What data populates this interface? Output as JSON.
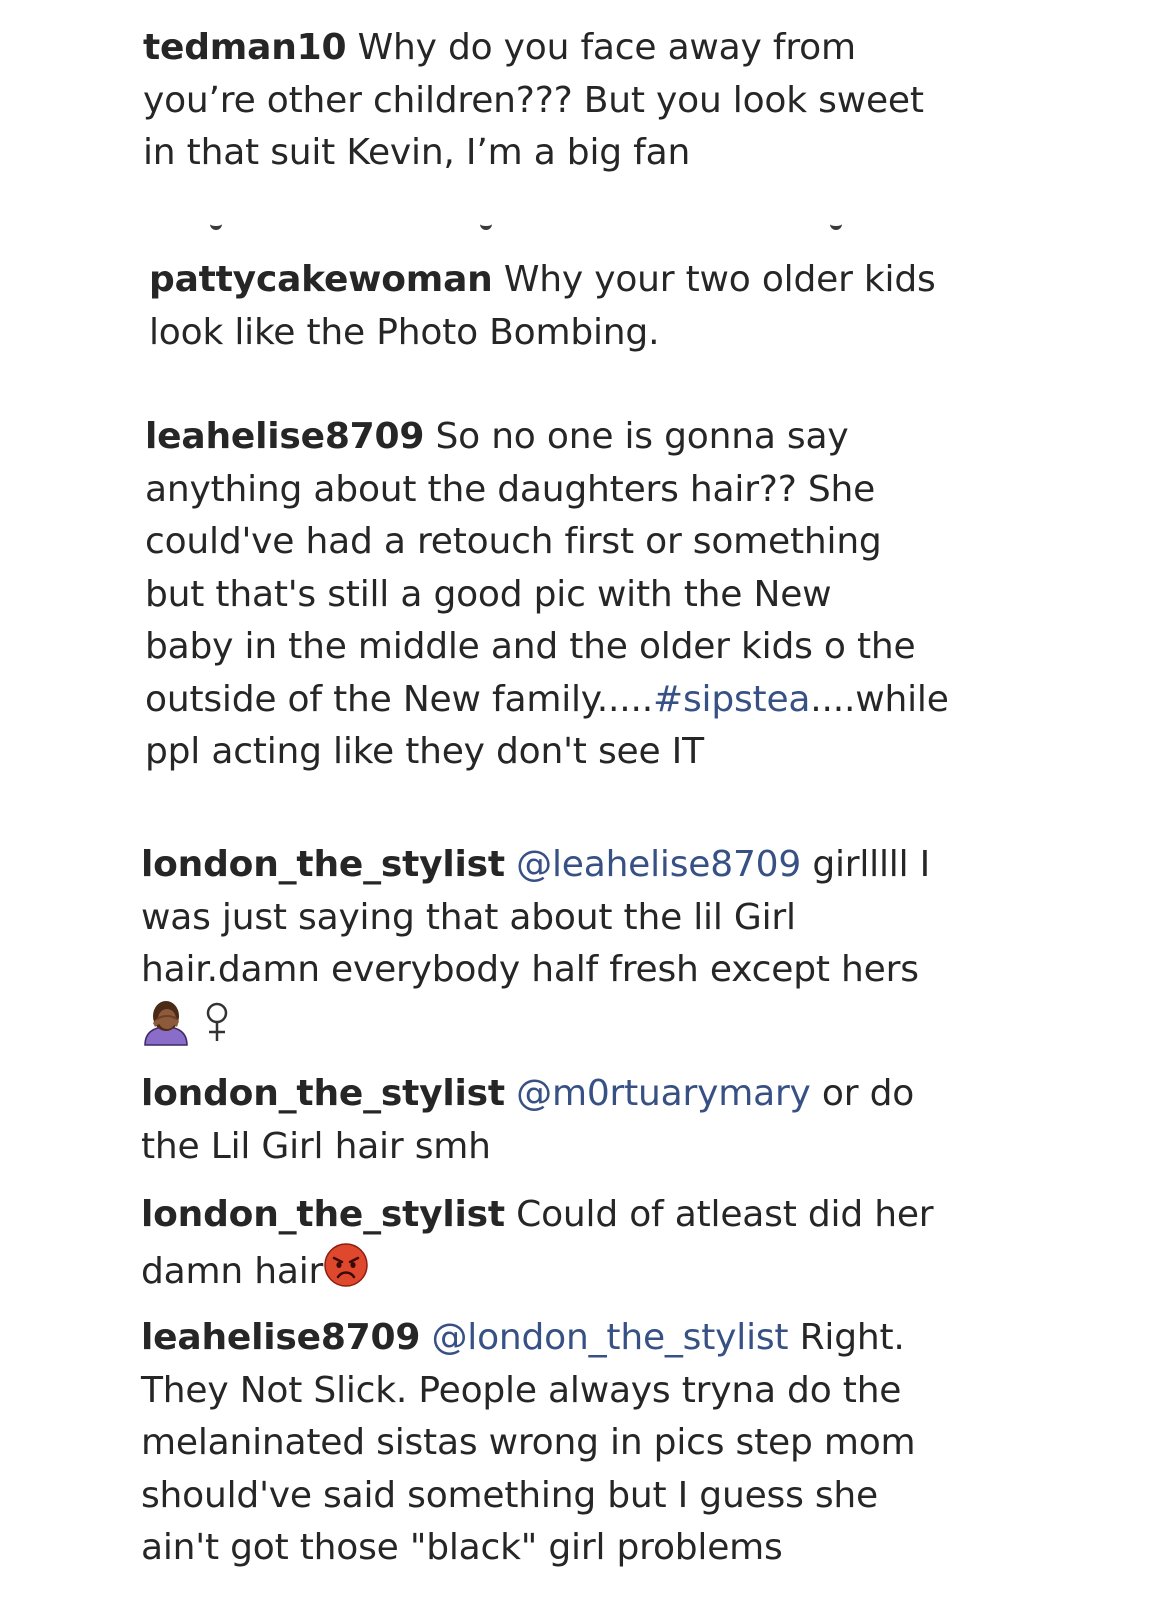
{
  "comments": [
    {
      "username": "tedman10",
      "lines": [
        "Why do you face away from",
        "you’re other children??? But you look sweet",
        "in that suit Kevin, I’m a big fan"
      ]
    },
    {
      "username": "pattycakewoman",
      "lines": [
        "Why your two older kids",
        "look like the Photo Bombing."
      ]
    },
    {
      "username": "leahelise8709",
      "lines": [
        "So no one is gonna say",
        "anything about the daughters hair?? She",
        "could've had a retouch first or something",
        "but that's still a good pic with the New",
        "baby in the middle and the older kids o the",
        "outside of the New family.....",
        "....while",
        "ppl acting like they don't see IT"
      ],
      "hashtag": "#sipstea"
    },
    {
      "username": "london_the_stylist",
      "mention": "@leahelise8709",
      "lines": [
        "girlllll I",
        "was just saying that about the lil Girl",
        "hair.damn everybody half fresh except hers"
      ],
      "emoji": [
        "woman-facepalming-emoji",
        "female-sign"
      ]
    },
    {
      "username": "london_the_stylist",
      "mention": "@m0rtuarymary",
      "lines": [
        "or do",
        "the Lil Girl hair smh"
      ]
    },
    {
      "username": "london_the_stylist",
      "lines": [
        "Could of atleast did her",
        "damn hair"
      ],
      "emoji": [
        "pouting-face-emoji"
      ]
    },
    {
      "username": "leahelise8709",
      "mention": "@london_the_stylist",
      "lines": [
        "Right.",
        "They Not Slick. People always tryna do the",
        "melaninated sistas wrong in pics step mom",
        "should've said something but I guess she",
        "ain't got those \"black\" girl problems"
      ]
    }
  ],
  "colors": {
    "text": "#262626",
    "link": "#385185",
    "background": "#ffffff"
  }
}
